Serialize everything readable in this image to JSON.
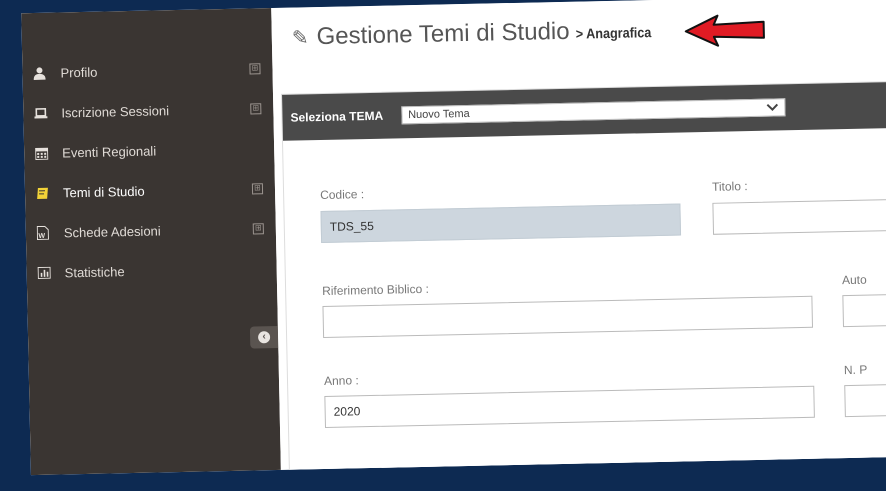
{
  "sidebar": {
    "items": [
      {
        "label": "Profilo",
        "icon": "user-icon",
        "expand": "⊞"
      },
      {
        "label": "Iscrizione Sessioni",
        "icon": "laptop-icon",
        "expand": "⊞"
      },
      {
        "label": "Eventi Regionali",
        "icon": "calendar-icon"
      },
      {
        "label": "Temi di Studio",
        "icon": "book-icon",
        "expand": "⊞",
        "active": true
      },
      {
        "label": "Schede Adesioni",
        "icon": "word-document-icon",
        "expand": "⊞"
      },
      {
        "label": "Statistiche",
        "icon": "bar-chart-icon"
      }
    ]
  },
  "header": {
    "title": "Gestione Temi di Studio",
    "breadcrumb": "> Anagrafica"
  },
  "panel": {
    "select_label": "Seleziona TEMA",
    "select_value": "Nuovo Tema"
  },
  "form": {
    "codice_label": "Codice :",
    "codice_value": "TDS_55",
    "titolo_label": "Titolo :",
    "titolo_value": "",
    "riferimento_label": "Riferimento Biblico :",
    "riferimento_value": "",
    "autore_label": "Auto",
    "anno_label": "Anno :",
    "anno_value": "2020",
    "npagine_label": "N. P"
  },
  "colors": {
    "background": "#0d2a52",
    "sidebar": "#3a3532",
    "panel_header": "#4a4a4a",
    "readonly_field": "#cdd6de",
    "arrow": "#e01b24",
    "active_icon": "#f2d338"
  }
}
